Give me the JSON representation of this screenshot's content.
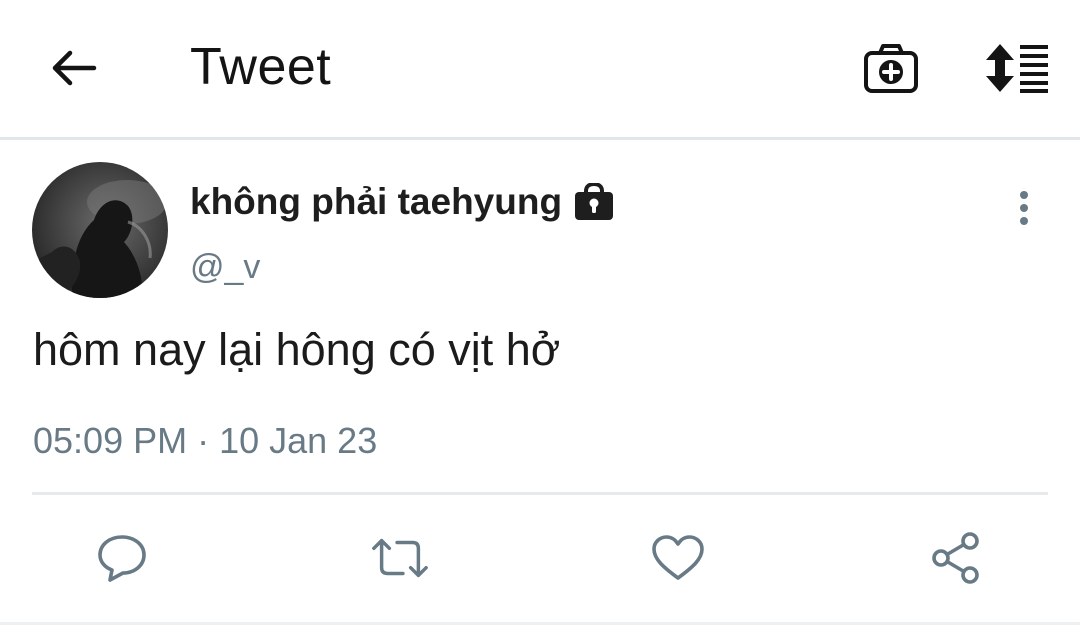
{
  "appbar": {
    "title": "Tweet",
    "back_icon": "arrow-left-icon",
    "camera_icon": "camera-plus-icon",
    "sort_icon": "sort-list-icon"
  },
  "tweet": {
    "display_name": "không phải taehyung",
    "protected_icon": "lock-icon",
    "handle": "@_v",
    "text": "hôm nay lại hông có vịt hở",
    "timestamp": "05:09 PM · 10 Jan 23",
    "more_icon": "more-vertical-icon"
  },
  "actions": {
    "reply_icon": "reply-bubble-icon",
    "retweet_icon": "retweet-icon",
    "like_icon": "heart-icon",
    "share_icon": "share-icon"
  },
  "colors": {
    "text_primary": "#1b1b1b",
    "text_secondary": "#687a86",
    "divider": "#e1e6ea",
    "icon_action": "#687a86"
  }
}
